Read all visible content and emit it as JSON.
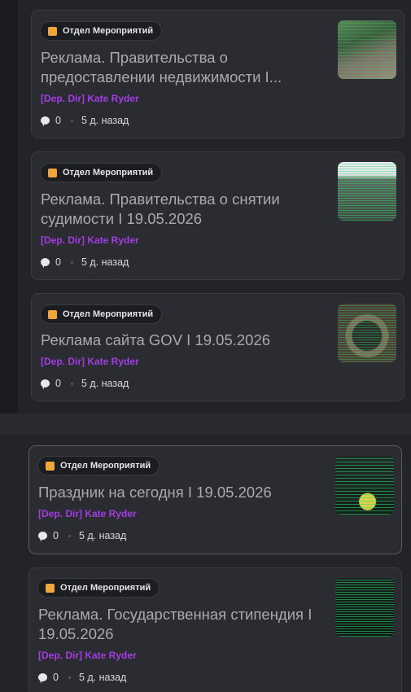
{
  "posts": [
    {
      "category": "Отдел Мероприятий",
      "title": "Реклама. Правительства о предоставлении недвижимости I...",
      "author": "[Dep. Dir] Kate Ryder",
      "comments": "0",
      "time": "5 д. назад",
      "thumbnail": "thumbnail-image"
    },
    {
      "category": "Отдел Мероприятий",
      "title": "Реклама. Правительства о снятии судимости I 19.05.2026",
      "author": "[Dep. Dir] Kate Ryder",
      "comments": "0",
      "time": "5 д. назад",
      "thumbnail": "thumbnail-image"
    },
    {
      "category": "Отдел Мероприятий",
      "title": "Реклама сайта GOV I 19.05.2026",
      "author": "[Dep. Dir] Kate Ryder",
      "comments": "0",
      "time": "5 д. назад",
      "thumbnail": "thumbnail-image"
    },
    {
      "category": "Отдел Мероприятий",
      "title": "Праздник на сегодня I 19.05.2026",
      "author": "[Dep. Dir] Kate Ryder",
      "comments": "0",
      "time": "5 д. назад",
      "thumbnail": "thumbnail-image"
    },
    {
      "category": "Отдел Мероприятий",
      "title": "Реклама. Государственная стипендия I 19.05.2026",
      "author": "[Dep. Dir] Kate Ryder",
      "comments": "0",
      "time": "5 д. назад",
      "thumbnail": "thumbnail-image"
    }
  ],
  "colors": {
    "category_icon": "#f0a63a",
    "author": "#a23ce3",
    "title": "#a9aaae",
    "card_bg": "#2b2c31"
  },
  "icons": {
    "category": "category-square-icon",
    "comments": "comment-bubble-icon"
  }
}
